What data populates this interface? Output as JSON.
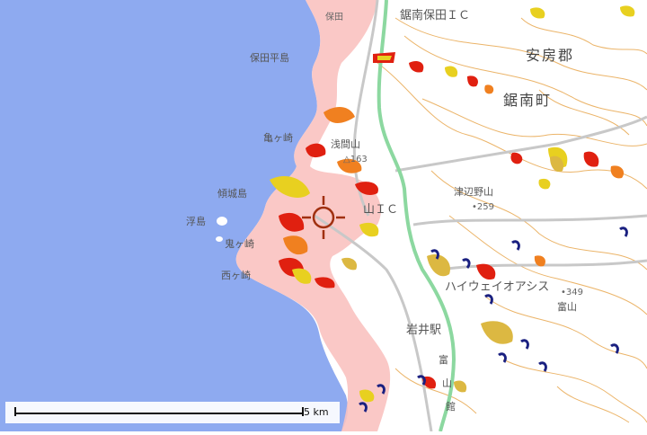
{
  "map": {
    "colors": {
      "sea": "#8eaaf0",
      "land": "#ffffff",
      "contour": "#e8a850",
      "coast_pink": "#f9c2c0",
      "hazard_red": "#e02010",
      "hazard_orange": "#f08020",
      "hazard_yellow": "#e8d020",
      "mustard": "#dcb842",
      "navy": "#1a2080",
      "expressway": "#8cd8a0",
      "road": "#c8c8c8"
    },
    "labels": {
      "district": "安房郡",
      "town": "鋸南町",
      "hotaichikan": "保田平島",
      "hota_top": "保田",
      "ic_top": "鋸南保田ＩＣ",
      "kamegasaki": "亀ヶ崎",
      "asamayama": "浅間山",
      "peak163": "163",
      "keijojima": "傾城島",
      "ic_mid": "山ＩＣ",
      "tsubenoyama": "津辺野山",
      "peak259": "259",
      "ukishima": "浮島",
      "onigasaki": "鬼ヶ崎",
      "nishigasaki": "西ヶ崎",
      "highway_oasis": "ハイウェイオアシス",
      "peak349": "349",
      "tomiyama": "富山",
      "iwai_station": "岩井駅",
      "vertical_tomi": "富",
      "vertical_yama": "山",
      "vertical_kan": "館"
    },
    "scale": {
      "label": "5 km"
    },
    "crosshair_icon": "crosshair-target-icon"
  }
}
